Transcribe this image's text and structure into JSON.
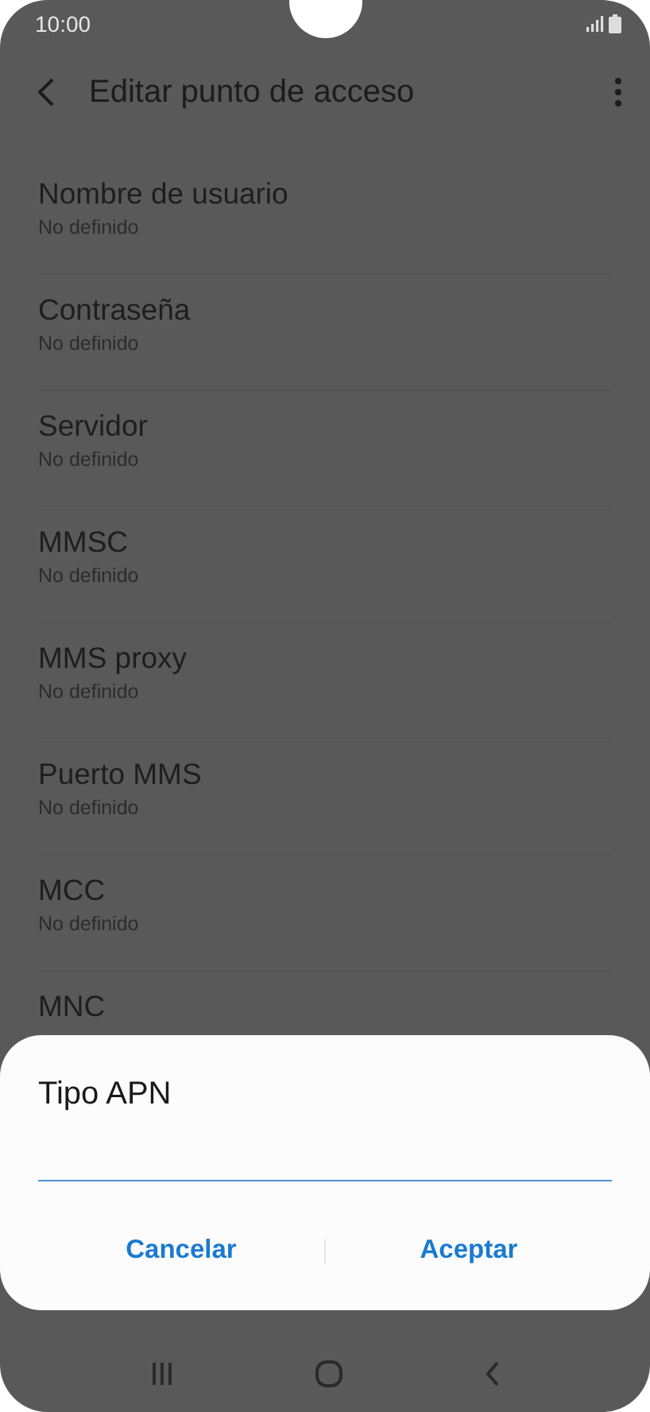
{
  "status_bar": {
    "time": "10:00"
  },
  "app_bar": {
    "title": "Editar punto de acceso"
  },
  "settings": [
    {
      "label": "Nombre de usuario",
      "value": "No definido"
    },
    {
      "label": "Contraseña",
      "value": "No definido"
    },
    {
      "label": "Servidor",
      "value": "No definido"
    },
    {
      "label": "MMSC",
      "value": "No definido"
    },
    {
      "label": "MMS proxy",
      "value": "No definido"
    },
    {
      "label": "Puerto MMS",
      "value": "No definido"
    },
    {
      "label": "MCC",
      "value": "No definido"
    },
    {
      "label": "MNC"
    }
  ],
  "dialog": {
    "title": "Tipo APN",
    "field": {
      "focused": true
    },
    "buttons": [
      "Cancelar",
      "Aceptar"
    ]
  }
}
